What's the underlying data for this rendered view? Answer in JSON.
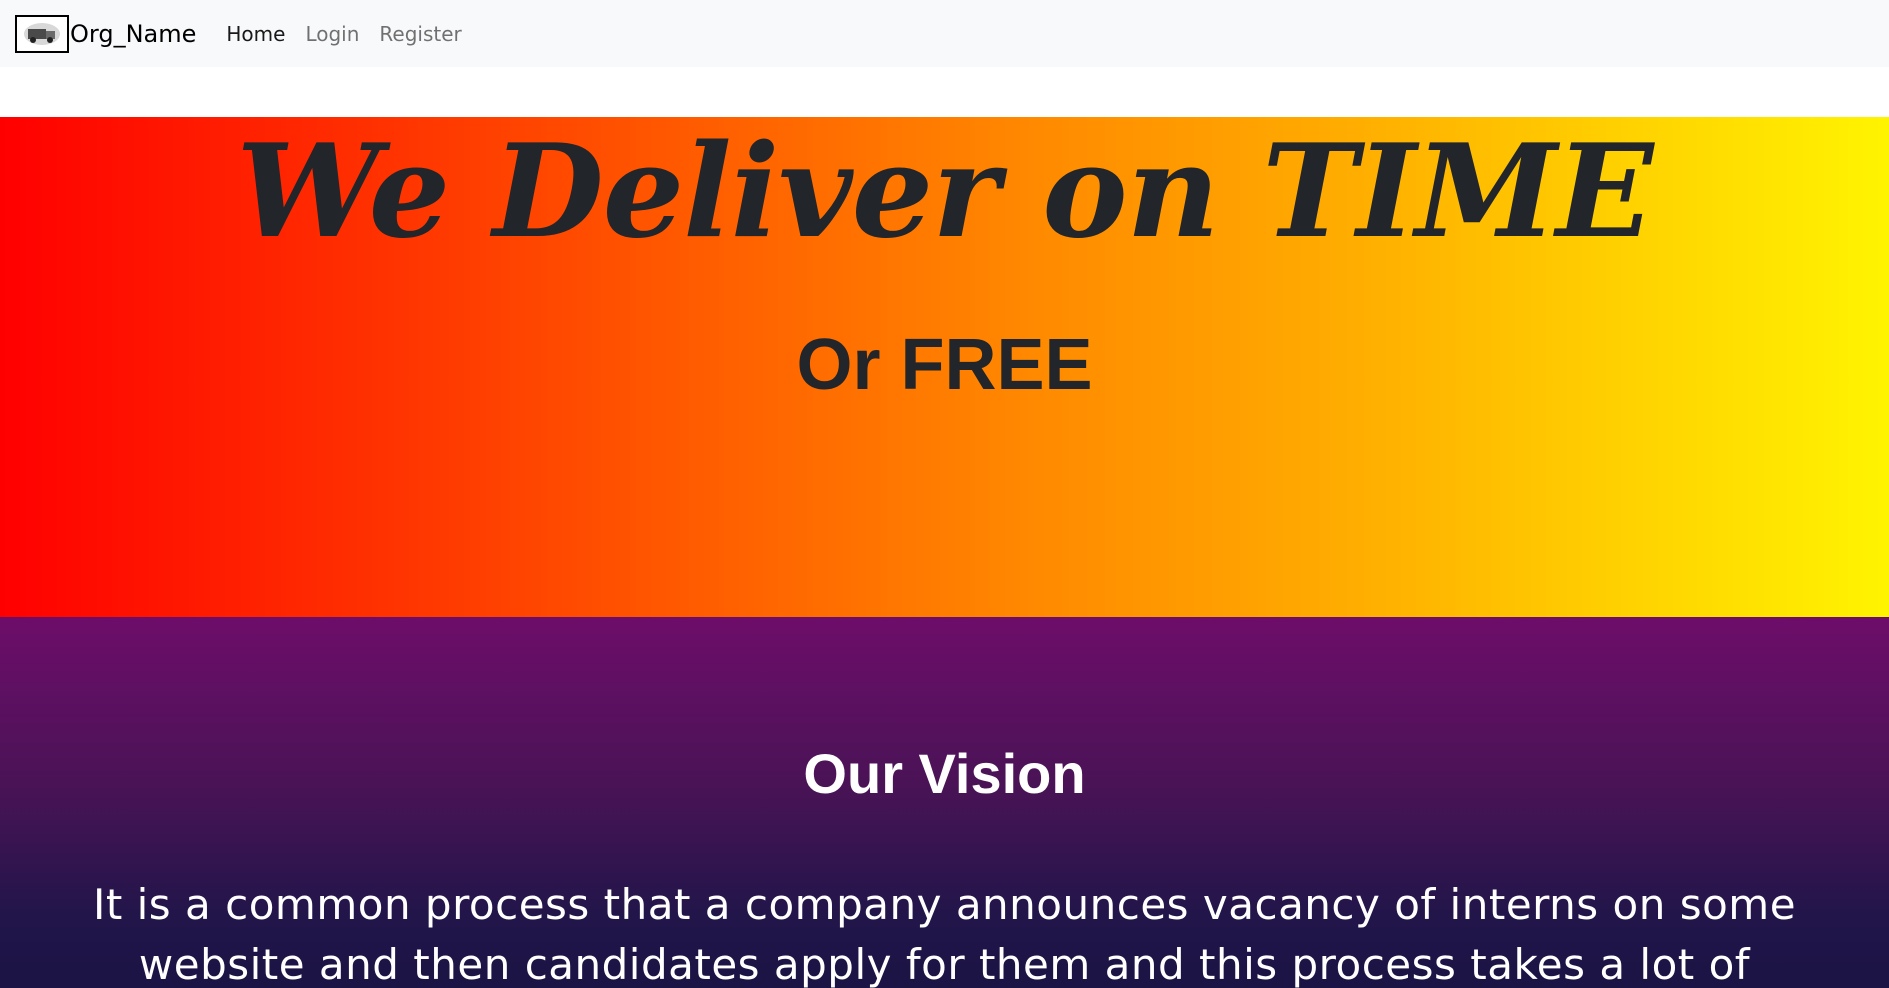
{
  "navbar": {
    "brand_name": "Org_Name",
    "logo_icon": "delivery-truck-logo",
    "links": [
      {
        "label": "Home",
        "active": true
      },
      {
        "label": "Login",
        "active": false
      },
      {
        "label": "Register",
        "active": false
      }
    ]
  },
  "hero": {
    "title": "We Deliver on TIME",
    "subtitle": "Or FREE",
    "gradient_colors": [
      "#ff0000",
      "#ff8a00",
      "#fff400"
    ],
    "text_color": "#222529"
  },
  "vision": {
    "title": "Our Vision",
    "text": "It is a common process that a company announces vacancy of interns on some website and then candidates apply for them and this process takes a lot of",
    "gradient_colors": [
      "#6d0d6a",
      "#1b1444"
    ],
    "text_color": "#ffffff"
  }
}
